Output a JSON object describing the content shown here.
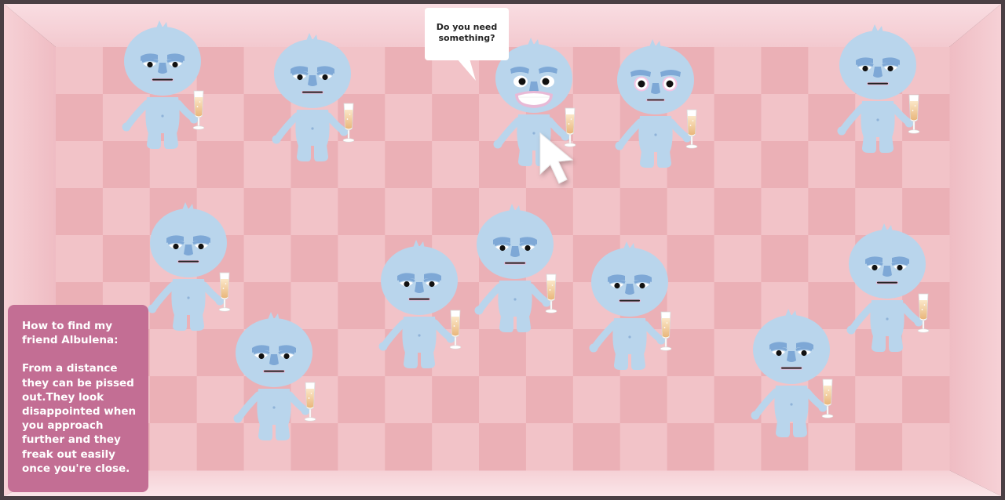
{
  "speech_bubble": {
    "text": "Do you need something?"
  },
  "hint": {
    "title": "How to find my friend Albulena:",
    "body": "From a distance they can be pissed out.They look disappointed when you approach further and they freak out easily once you're close."
  },
  "characters": [
    {
      "id": 1,
      "expression": "disappointed"
    },
    {
      "id": 2,
      "expression": "disappointed"
    },
    {
      "id": 3,
      "expression": "grinning"
    },
    {
      "id": 4,
      "expression": "wide-eyed"
    },
    {
      "id": 5,
      "expression": "disappointed"
    },
    {
      "id": 6,
      "expression": "disappointed"
    },
    {
      "id": 7,
      "expression": "disappointed"
    },
    {
      "id": 8,
      "expression": "disappointed"
    },
    {
      "id": 9,
      "expression": "disappointed"
    },
    {
      "id": 10,
      "expression": "disappointed"
    },
    {
      "id": 11,
      "expression": "disappointed"
    },
    {
      "id": 12,
      "expression": "disappointed"
    }
  ],
  "colors": {
    "floor_light": "#f2c3c8",
    "floor_dark": "#ebb0b6",
    "wall": "#f5cbd1",
    "character_skin": "#b9d5ec",
    "character_shade": "#7ea8d6",
    "hint_box": "#c36e94",
    "frame": "#4a3f44"
  },
  "icons": {
    "cursor": "arrow-cursor-icon",
    "glass": "champagne-glass-icon"
  }
}
